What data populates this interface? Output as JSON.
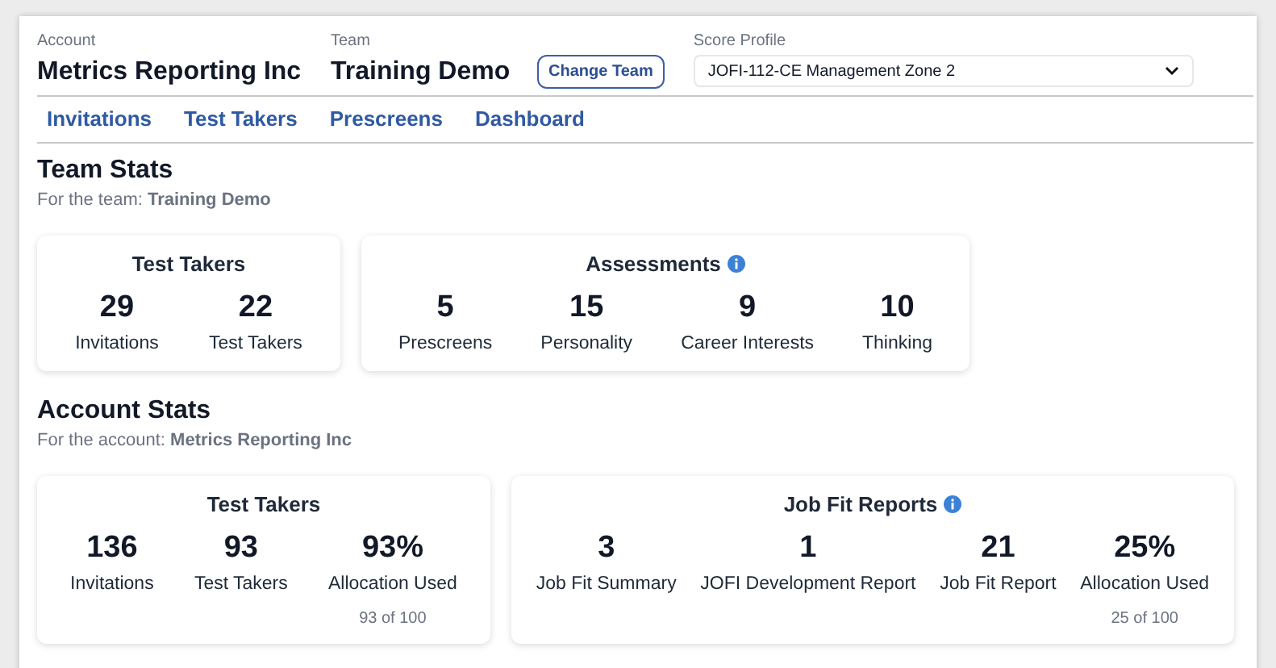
{
  "header": {
    "account": {
      "label": "Account",
      "value": "Metrics Reporting Inc"
    },
    "team": {
      "label": "Team",
      "value": "Training Demo"
    },
    "change_team_button": "Change Team",
    "score_profile": {
      "label": "Score Profile",
      "value": "JOFI-112-CE Management Zone 2"
    }
  },
  "tabs": [
    {
      "label": "Invitations"
    },
    {
      "label": "Test Takers"
    },
    {
      "label": "Prescreens"
    },
    {
      "label": "Dashboard"
    }
  ],
  "sections": [
    {
      "title": "Team Stats",
      "subtitle": "For the team: **Training Demo**",
      "cards": [
        {
          "title": "Test Takers",
          "info": false,
          "stats": [
            {
              "value": "29",
              "label": "Invitations"
            },
            {
              "value": "22",
              "label": "Test Takers"
            }
          ]
        },
        {
          "title": "Assessments",
          "info": true,
          "stats": [
            {
              "value": "5",
              "label": "Prescreens"
            },
            {
              "value": "15",
              "label": "Personality"
            },
            {
              "value": "9",
              "label": "Career Interests"
            },
            {
              "value": "10",
              "label": "Thinking"
            }
          ]
        }
      ]
    },
    {
      "title": "Account Stats",
      "subtitle": "For the account: **Metrics Reporting Inc**",
      "cards": [
        {
          "title": "Test Takers",
          "info": false,
          "stats": [
            {
              "value": "136",
              "label": "Invitations"
            },
            {
              "value": "93",
              "label": "Test Takers"
            },
            {
              "value": "93%",
              "label": "Allocation Used",
              "note": "93 of 100"
            }
          ]
        },
        {
          "title": "Job Fit Reports",
          "info": true,
          "stats": [
            {
              "value": "3",
              "label": "Job Fit Summary"
            },
            {
              "value": "1",
              "label": "JOFI Development Report"
            },
            {
              "value": "21",
              "label": "Job Fit Report"
            },
            {
              "value": "25%",
              "label": "Allocation Used",
              "note": "25 of 100"
            }
          ]
        }
      ]
    }
  ]
}
